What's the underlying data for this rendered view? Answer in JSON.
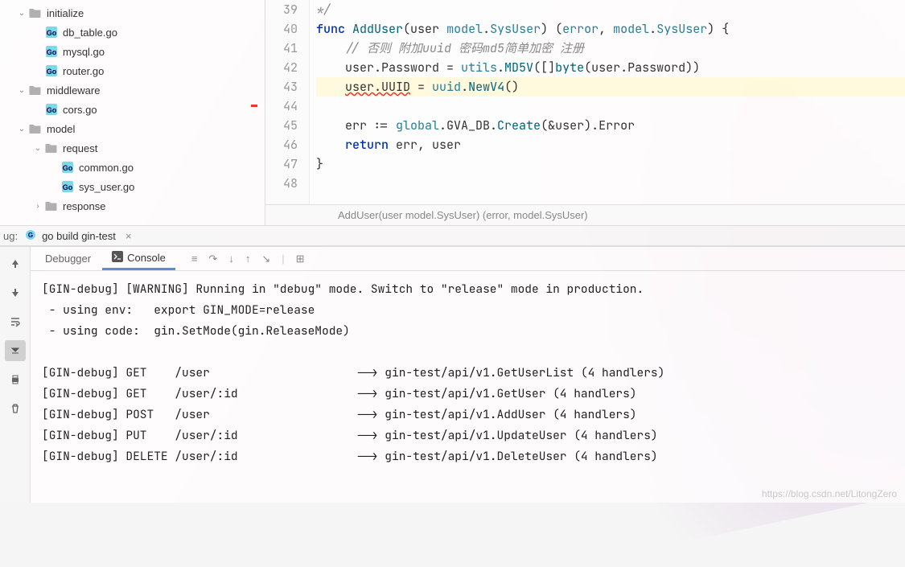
{
  "sidebar": {
    "items": [
      {
        "label": "initialize",
        "type": "folder",
        "indent": 1,
        "expanded": true
      },
      {
        "label": "db_table.go",
        "type": "go",
        "indent": 2
      },
      {
        "label": "mysql.go",
        "type": "go",
        "indent": 2
      },
      {
        "label": "router.go",
        "type": "go",
        "indent": 2
      },
      {
        "label": "middleware",
        "type": "folder",
        "indent": 1,
        "expanded": true
      },
      {
        "label": "cors.go",
        "type": "go",
        "indent": 2
      },
      {
        "label": "model",
        "type": "folder",
        "indent": 1,
        "expanded": true
      },
      {
        "label": "request",
        "type": "folder",
        "indent": 2,
        "expanded": true
      },
      {
        "label": "common.go",
        "type": "go",
        "indent": 3
      },
      {
        "label": "sys_user.go",
        "type": "go",
        "indent": 3
      },
      {
        "label": "response",
        "type": "folder",
        "indent": 2,
        "expanded": false
      }
    ]
  },
  "editor": {
    "startLine": 39,
    "lines": [
      {
        "n": 39,
        "html": "<span class='comment'>*/</span>"
      },
      {
        "n": 40,
        "html": "<span class='kw'>func</span> <span class='fn'>AddUser</span>(user <span class='type'>model</span>.<span class='type'>SysUser</span>) (<span class='type'>error</span>, <span class='type'>model</span>.<span class='type'>SysUser</span>) {"
      },
      {
        "n": 41,
        "html": "    <span class='comment'>// 否则 附加uuid 密码md5简单加密 注册</span>"
      },
      {
        "n": 42,
        "html": "    user.Password = <span class='type'>utils</span>.<span class='fn'>MD5V</span>([]<span class='fn'>byte</span>(user.Password))"
      },
      {
        "n": 43,
        "html": "    <span class='err-underline'>user.UUID</span> = <span class='type'>uuid</span>.<span class='fn'>NewV4</span>()",
        "highlight": true
      },
      {
        "n": 44,
        "html": ""
      },
      {
        "n": 45,
        "html": "    err := <span class='type'>global</span>.GVA_DB.<span class='fn'>Create</span>(&user).Error"
      },
      {
        "n": 46,
        "html": "    <span class='kw'>return</span> err, user"
      },
      {
        "n": 47,
        "html": "}"
      },
      {
        "n": 48,
        "html": ""
      }
    ],
    "breadcrumb": "AddUser(user model.SysUser) (error, model.SysUser)"
  },
  "debugBar": {
    "label": "ug:",
    "config": "go build gin-test"
  },
  "panel": {
    "tabs": {
      "debugger": "Debugger",
      "console": "Console"
    },
    "console_lines": [
      "[GIN-debug] [WARNING] Running in \"debug\" mode. Switch to \"release\" mode in production.",
      " - using env:   export GIN_MODE=release",
      " - using code:  gin.SetMode(gin.ReleaseMode)",
      "",
      "[GIN-debug] GET    /user                     --> gin-test/api/v1.GetUserList (4 handlers)",
      "[GIN-debug] GET    /user/:id                 --> gin-test/api/v1.GetUser (4 handlers)",
      "[GIN-debug] POST   /user                     --> gin-test/api/v1.AddUser (4 handlers)",
      "[GIN-debug] PUT    /user/:id                 --> gin-test/api/v1.UpdateUser (4 handlers)",
      "[GIN-debug] DELETE /user/:id                 --> gin-test/api/v1.DeleteUser (4 handlers)"
    ]
  },
  "watermark": "https://blog.csdn.net/LitongZero"
}
